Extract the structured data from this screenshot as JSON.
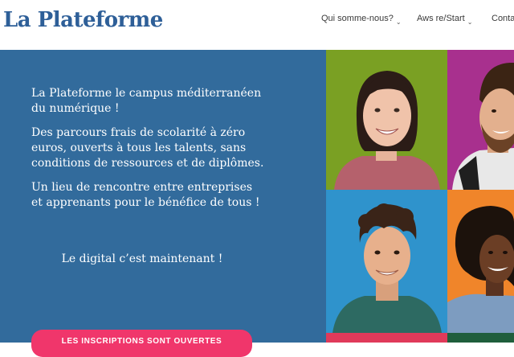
{
  "header": {
    "logo": "La Plateforme",
    "nav": [
      {
        "label": "Qui somme-nous?",
        "has_dropdown": true
      },
      {
        "label": "Aws re/Start",
        "has_dropdown": true
      },
      {
        "label": "Contac",
        "has_dropdown": false
      }
    ]
  },
  "hero": {
    "paragraphs": [
      "La Plateforme le campus méditerranéen du numérique !",
      "Des parcours frais de scolarité à zéro euros, ouverts à tous les talents, sans conditions de ressources et de diplômes.",
      "Un lieu de rencontre entre entreprises et apprenants pour le bénéfice de tous !"
    ],
    "tagline": "Le digital c’est maintenant !",
    "cta_label": "LES INSCRIPTIONS SONT OUVERTES"
  },
  "photos": [
    {
      "background": "#7aa023",
      "shirt": "#b5616c",
      "description": "smiling woman with dark hair"
    },
    {
      "background": "#a8308e",
      "shirt": "#e8e8e8",
      "description": "smiling man with beard"
    },
    {
      "background": "#2f93cc",
      "shirt": "#2d6a62",
      "description": "smiling young man with curly hair"
    },
    {
      "background": "#f0852a",
      "shirt": "#7d9cc0",
      "description": "smiling woman with curly hair"
    }
  ],
  "colors": {
    "brand_blue": "#2e5f98",
    "hero_blue": "#326b9c",
    "cta_pink": "#f0366b"
  }
}
